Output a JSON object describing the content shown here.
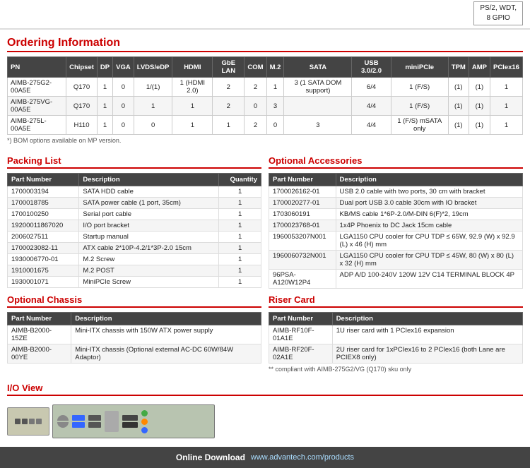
{
  "topStrip": {
    "specLabel": "PS/2, WDT,\n8 GPIO"
  },
  "orderingInfo": {
    "title": "Ordering Information",
    "note": "*) BOM options available on MP version.",
    "columns": [
      "PN",
      "Chipset",
      "DP",
      "VGA",
      "LVDS/eDP",
      "HDMI",
      "GbE LAN",
      "COM",
      "M.2",
      "SATA",
      "USB 3.0/2.0",
      "miniPCIe",
      "TPM",
      "AMP",
      "PCIex16"
    ],
    "rows": [
      [
        "AIMB-275G2-00A5E",
        "Q170",
        "1",
        "0",
        "1/(1)",
        "1 (HDMI 2.0)",
        "2",
        "2",
        "1",
        "3 (1 SATA DOM support)",
        "6/4",
        "1 (F/S)",
        "(1)",
        "(1)",
        "1"
      ],
      [
        "AIMB-275VG-00A5E",
        "Q170",
        "1",
        "0",
        "1",
        "1",
        "2",
        "0",
        "3",
        "",
        "4/4",
        "1 (F/S)",
        "(1)",
        "(1)",
        "1"
      ],
      [
        "AIMB-275L-00A5E",
        "H110",
        "1",
        "0",
        "0",
        "1",
        "1",
        "2",
        "0",
        "3",
        "4/4",
        "1 (F/S) mSATA only",
        "(1)",
        "(1)",
        "1"
      ]
    ]
  },
  "packingList": {
    "title": "Packing List",
    "columns": [
      "Part Number",
      "Description",
      "Quantity"
    ],
    "rows": [
      [
        "1700003194",
        "SATA HDD cable",
        "1"
      ],
      [
        "1700018785",
        "SATA power cable (1 port, 35cm)",
        "1"
      ],
      [
        "1700100250",
        "Serial port cable",
        "1"
      ],
      [
        "19200011867020",
        "I/O port bracket",
        "1"
      ],
      [
        "2006027511",
        "Startup manual",
        "1"
      ],
      [
        "1700023082-11",
        "ATX cable 2*10P-4.2/1*3P-2.0 15cm",
        "1"
      ],
      [
        "1930006770-01",
        "M.2 Screw",
        "1"
      ],
      [
        "1910001675",
        "M.2 POST",
        "1"
      ],
      [
        "1930001071",
        "MiniPCIe Screw",
        "1"
      ]
    ]
  },
  "optionalAccessories": {
    "title": "Optional Accessories",
    "columns": [
      "Part Number",
      "Description"
    ],
    "rows": [
      [
        "1700026162-01",
        "USB 2.0 cable with two ports, 30 cm with bracket"
      ],
      [
        "1700020277-01",
        "Dual port USB 3.0 cable 30cm with IO bracket"
      ],
      [
        "1703060191",
        "KB/MS cable 1*6P-2.0/M-DIN 6(F)*2, 19cm"
      ],
      [
        "1700023768-01",
        "1x4P Phoenix to DC Jack 15cm cable"
      ],
      [
        "1960053207N001",
        "LGA1150 CPU cooler for CPU TDP ≤ 65W, 92.9 (W) x 92.9 (L) x 46 (H) mm"
      ],
      [
        "1960060732N001",
        "LGA1150 CPU cooler for CPU TDP ≤ 45W, 80 (W) x 80 (L) x 32 (H) mm"
      ],
      [
        "96PSA-A120W12P4",
        "ADP A/D 100-240V 120W 12V C14 TERMINAL BLOCK 4P"
      ]
    ]
  },
  "optionalChassis": {
    "title": "Optional Chassis",
    "columns": [
      "Part Number",
      "Description"
    ],
    "rows": [
      [
        "AIMB-B2000-15ZE",
        "Mini-ITX chassis with 150W ATX power supply"
      ],
      [
        "AIMB-B2000-00YE",
        "Mini-ITX chassis (Optional external AC-DC 60W/84W Adaptor)"
      ]
    ]
  },
  "riserCard": {
    "title": "Riser Card",
    "columns": [
      "Part Number",
      "Description"
    ],
    "rows": [
      [
        "AIMB-RF10F-01A1E",
        "1U riser card with 1 PCIex16 expansion"
      ],
      [
        "AIMB-RF20F-02A1E",
        "2U riser card for 1xPCIex16 to 2 PCIex16 (both Lane are PCIEX8 only)"
      ]
    ],
    "note": "** compliant with AIMB-275G2/VG (Q170) sku only"
  },
  "ioView": {
    "title": "I/O View"
  },
  "onlineDownload": {
    "label": "Online Download",
    "url": "www.advantech.com/products"
  }
}
